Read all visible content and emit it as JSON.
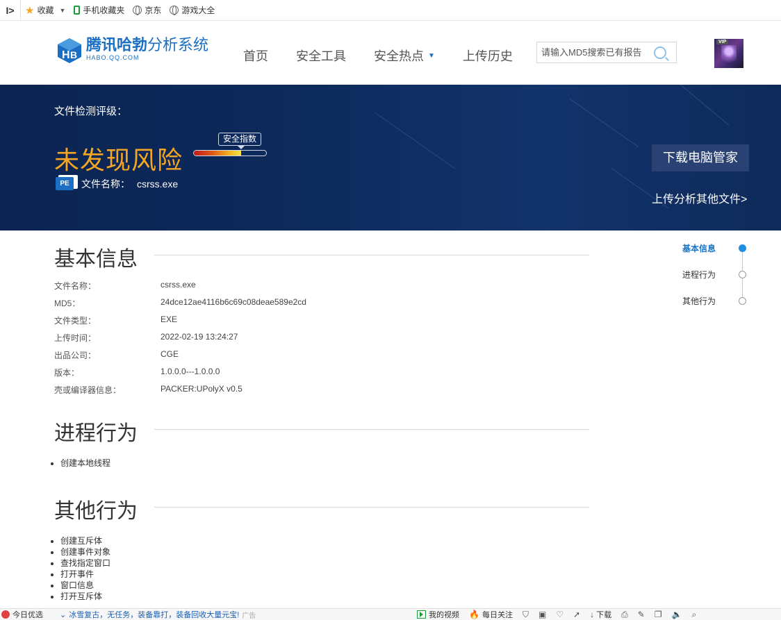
{
  "bookmarks": {
    "toggle": "I>",
    "items": [
      {
        "label": "收藏",
        "icon": "star-icon"
      },
      {
        "label": "手机收藏夹",
        "icon": "phone-icon"
      },
      {
        "label": "京东",
        "icon": "globe-icon"
      },
      {
        "label": "游戏大全",
        "icon": "globe-icon"
      }
    ]
  },
  "header": {
    "logo_title_bold": "腾讯哈勃",
    "logo_title_light": "分析系统",
    "logo_sub": "HABO.QQ.COM",
    "nav": [
      "首页",
      "安全工具",
      "安全热点",
      "上传历史"
    ],
    "search_placeholder": "请输入MD5搜索已有报告",
    "avatar_badge": "VIP"
  },
  "hero": {
    "label": "文件检测评级：",
    "risk_text": "未发现风险",
    "score_label": "安全指数",
    "score_fraction": 0.65,
    "pe_badge": "PE",
    "file_label": "文件名称：",
    "file_name": "csrss.exe",
    "download_button": "下载电脑管家",
    "upload_link": "上传分析其他文件>"
  },
  "basic": {
    "title": "基本信息",
    "rows": [
      {
        "label": "文件名称：",
        "value": "csrss.exe"
      },
      {
        "label": "MD5：",
        "value": "24dce12ae4116b6c69c08deae589e2cd"
      },
      {
        "label": "文件类型：",
        "value": "EXE"
      },
      {
        "label": "上传时间：",
        "value": "2022-02-19 13:24:27"
      },
      {
        "label": "出品公司：",
        "value": "CGE"
      },
      {
        "label": "版本：",
        "value": "1.0.0.0---1.0.0.0"
      },
      {
        "label": "壳或编译器信息：",
        "value": "PACKER:UPolyX v0.5"
      }
    ]
  },
  "process": {
    "title": "进程行为",
    "items": [
      "创建本地线程"
    ]
  },
  "other": {
    "title": "其他行为",
    "items": [
      "创建互斥体",
      "创建事件对象",
      "查找指定窗口",
      "打开事件",
      "窗口信息",
      "打开互斥体"
    ]
  },
  "anchor_nav": [
    "基本信息",
    "进程行为",
    "其他行为"
  ],
  "status_bar": {
    "left_label": "今日优选",
    "news": "冰雪复古，无任务，装备靠打，装备回收大量元宝!",
    "ad": "广告",
    "video": "我的视频",
    "follow": "每日关注",
    "download": "下载"
  }
}
